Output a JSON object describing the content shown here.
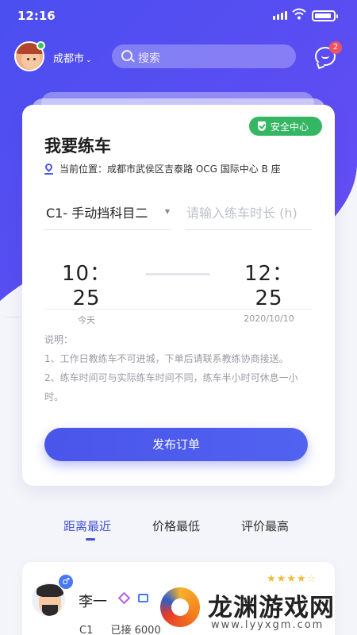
{
  "status_bar": {
    "time": "12:16"
  },
  "header": {
    "city": "成都市",
    "search_placeholder": "搜索",
    "message_badge": "2"
  },
  "card": {
    "safety_label": "安全中心",
    "title": "我要练车",
    "location_label": "当前位置：",
    "location_value": "成都市武侯区吉泰路 OCG 国际中心 B 座",
    "course_select": "C1- 手动挡科目二",
    "duration_placeholder": "请输入练车时长 (h)",
    "start_time": "10： 25",
    "start_date": "今天",
    "end_time": "12： 25",
    "end_date": "2020/10/10",
    "notes_title": "说明：",
    "notes": [
      "1、工作日教练车不可进城，下单后请联系教练协商接送。",
      "2、练车时间可与实际练车时间不同，练车半小时可休息一小时。"
    ],
    "publish_label": "发布订单"
  },
  "tabs": [
    {
      "label": "距离最近",
      "active": true
    },
    {
      "label": "价格最低",
      "active": false
    },
    {
      "label": "评价最高",
      "active": false
    }
  ],
  "coach": {
    "name": "李一",
    "gender_symbol": "♂",
    "license": "C1",
    "orders": "已接 6000",
    "rating": 4
  },
  "watermark": {
    "title": "龙渊游戏网",
    "url": "www.lyyxgm.com"
  },
  "colors": {
    "primary": "#4a55ea",
    "safety_green": "#35b663",
    "badge_red": "#f25260"
  }
}
